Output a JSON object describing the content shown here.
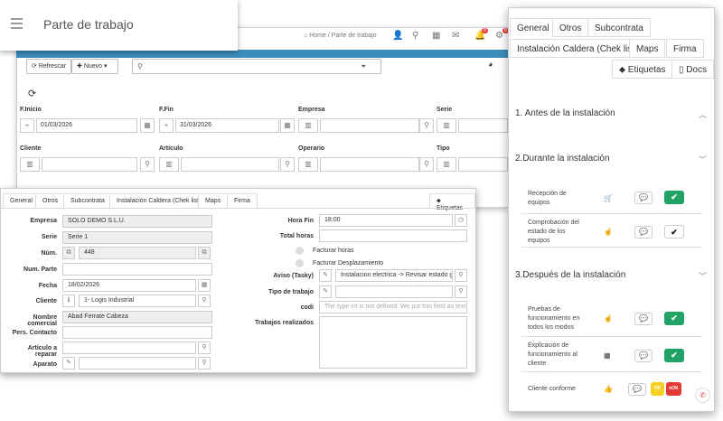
{
  "app": {
    "title": "Parte de trabajo"
  },
  "breadcrumb": {
    "home": "Home",
    "sep": "/",
    "current": "Parte de trabajo"
  },
  "header": {
    "badges": [
      "8",
      "8"
    ]
  },
  "toolbar": {
    "refresh": "Refrescar",
    "new": "Nuevo",
    "search_placeholder": ""
  },
  "filters": {
    "f_inicio": {
      "label": "F.Inicio",
      "value": "01/03/2026"
    },
    "f_fin": {
      "label": "F.Fin",
      "value": "31/03/2026"
    },
    "empresa": {
      "label": "Empresa"
    },
    "serie": {
      "label": "Serie"
    },
    "cliente": {
      "label": "Cliente"
    },
    "articulo": {
      "label": "Artículo"
    },
    "operario": {
      "label": "Operario"
    },
    "tipo": {
      "label": "Tipo"
    }
  },
  "form": {
    "tabs": [
      "General",
      "Otros",
      "Subcontrata",
      "Instalación Caldera (Chek list)",
      "Maps",
      "Firma"
    ],
    "tags_button": "Etiquetas",
    "empresa": {
      "label": "Empresa",
      "value": "SOLO DEMO S.L.U."
    },
    "serie": {
      "label": "Serie",
      "value": "Serie 1"
    },
    "num": {
      "label": "Núm.",
      "value": "448"
    },
    "num_parte": {
      "label": "Num. Parte",
      "value": ""
    },
    "fecha": {
      "label": "Fecha",
      "value": "18/02/2026"
    },
    "cliente": {
      "label": "Cliente",
      "value": "1- Logis Industrial"
    },
    "nombre_comercial": {
      "label": "Nombre comercial",
      "value": "Abad Ferrate Cabeza"
    },
    "pers_contacto": {
      "label": "Pers. Contacto",
      "value": ""
    },
    "articulo_reparar": {
      "label": "Artículo a reparar",
      "value": ""
    },
    "aparato": {
      "label": "Aparato",
      "value": ""
    },
    "hora_fin": {
      "label": "Hora Fin",
      "value": "18:00"
    },
    "total_horas": {
      "label": "Total horas",
      "value": ""
    },
    "facturar_horas": "Facturar horas",
    "facturar_desplazamiento": "Facturar Desplazamiento",
    "aviso": {
      "label": "Aviso (Tasky)",
      "value": "Instalacion electrica -> Revisar estado gen"
    },
    "tipo_trabajo": {
      "label": "Tipo de trabajo",
      "value": ""
    },
    "codi": {
      "label": "codi",
      "placeholder": "The type int is not defined. We put this field as text"
    },
    "trabajos": {
      "label": "Trabajos realizados",
      "value": ""
    }
  },
  "checklist": {
    "tabs_row1": [
      "General",
      "Otros",
      "Subcontrata"
    ],
    "tabs_row2": [
      "Instalación Caldera (Chek list)",
      "Maps",
      "Firma"
    ],
    "tabs_row3": [
      "Etiquetas",
      "Docs"
    ],
    "sections": [
      {
        "title": "1. Antes de la instalación",
        "items": []
      },
      {
        "title": "2.Durante la instalación",
        "items": [
          {
            "label": "Recepción de equipos",
            "icon": "cart-icon",
            "state": "ok"
          },
          {
            "label": "Comprobación del estado de los equipos",
            "icon": "hand-icon",
            "state": "check"
          }
        ]
      },
      {
        "title": "3.Después de la instalación",
        "items": [
          {
            "label": "Pruebas de funcionamiento en todos los modos",
            "icon": "hand-icon",
            "state": "ok"
          },
          {
            "label": "Explicación de funcionamiento al cliente",
            "icon": "calendar-icon",
            "state": "ok"
          },
          {
            "label": "Cliente conforme",
            "icon": "thumb-icon",
            "state": "okno"
          }
        ]
      }
    ],
    "ok_label": "OK",
    "nok_label": "nOK"
  },
  "colors": {
    "accent": "#3c8dbc",
    "green": "#21a366",
    "yellow": "#f5d020",
    "red": "#e53935"
  }
}
